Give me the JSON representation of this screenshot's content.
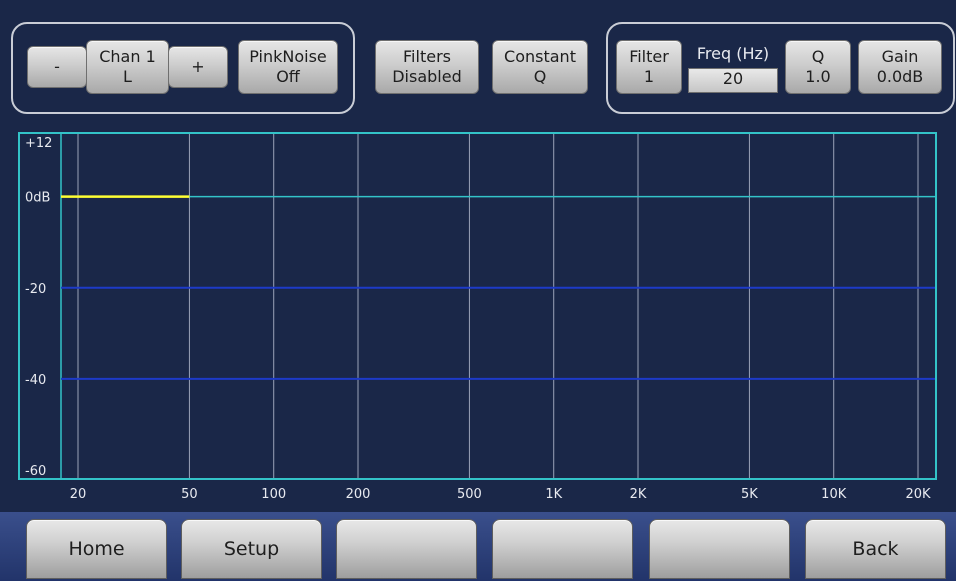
{
  "controls": {
    "channel": {
      "minus_label": "-",
      "name_line1": "Chan 1",
      "name_line2": "L",
      "plus_label": "+",
      "pinknoise_line1": "PinkNoise",
      "pinknoise_line2": "Off"
    },
    "filters_line1": "Filters",
    "filters_line2": "Disabled",
    "mode_line1": "Constant",
    "mode_line2": "Q",
    "filter": {
      "label_line1": "Filter",
      "label_line2": "1",
      "freq_label": "Freq (Hz)",
      "freq_value": "20",
      "q_line1": "Q",
      "q_line2": "1.0",
      "gain_line1": "Gain",
      "gain_line2": "0.0dB"
    }
  },
  "graph": {
    "y_labels": [
      "+12",
      "0dB",
      "-20",
      "-40",
      "-60"
    ],
    "x_labels": [
      "20",
      "50",
      "100",
      "200",
      "500",
      "1K",
      "2K",
      "5K",
      "10K",
      "20K"
    ],
    "colors": {
      "background": "#1a2748",
      "border": "#33c3c8",
      "zero_line": "#33c3c8",
      "major_lines": "#1d3ac8",
      "vertical_grid": "#9aa3b8",
      "response": "#ffff33"
    }
  },
  "chart_data": {
    "type": "line",
    "y_ticks": [
      12,
      0,
      -20,
      -40,
      -60
    ],
    "ylim": [
      -60,
      12
    ],
    "x_ticks": [
      20,
      50,
      100,
      200,
      500,
      1000,
      2000,
      5000,
      10000,
      20000
    ],
    "x_tick_labels": [
      "20",
      "50",
      "100",
      "200",
      "500",
      "1K",
      "2K",
      "5K",
      "10K",
      "20K"
    ],
    "xlim": [
      20,
      20000
    ],
    "x_scale": "log",
    "grid": true,
    "series": [
      {
        "x": [
          20,
          50
        ],
        "y": [
          0,
          0
        ],
        "color": "#ffff33"
      }
    ]
  },
  "bottom_nav": [
    "Home",
    "Setup",
    "",
    "",
    "",
    "Back"
  ]
}
